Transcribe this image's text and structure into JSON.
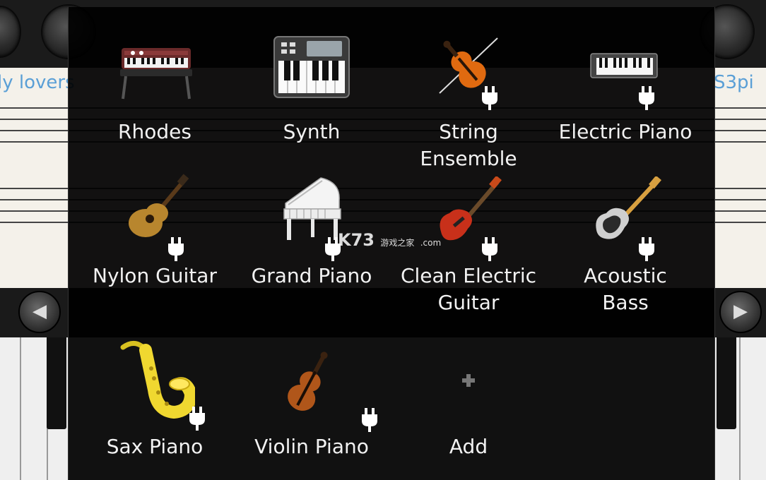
{
  "background": {
    "sheet_title_left": "ly lovers",
    "sheet_title_right": "S3pi",
    "nav_left_arrow": "◀",
    "nav_right_arrow": "▶"
  },
  "instrument_dialog": {
    "instruments": [
      {
        "label": "Rhodes",
        "icon": "rhodes-keyboard-icon",
        "plugin": false
      },
      {
        "label": "Synth",
        "icon": "synth-keyboard-icon",
        "plugin": false
      },
      {
        "label": "String\nEnsemble",
        "icon": "violin-bow-icon",
        "plugin": true
      },
      {
        "label": "Electric Piano",
        "icon": "electric-piano-icon",
        "plugin": true
      },
      {
        "label": "Nylon Guitar",
        "icon": "nylon-guitar-icon",
        "plugin": true
      },
      {
        "label": "Grand Piano",
        "icon": "grand-piano-icon",
        "plugin": true
      },
      {
        "label": "Clean Electric\nGuitar",
        "icon": "electric-guitar-icon",
        "plugin": true
      },
      {
        "label": "Acoustic\nBass",
        "icon": "bass-guitar-icon",
        "plugin": true
      },
      {
        "label": "Sax Piano",
        "icon": "saxophone-icon",
        "plugin": true
      },
      {
        "label": "Violin Piano",
        "icon": "violin-icon",
        "plugin": true
      },
      {
        "label": "Add",
        "icon": "plus-icon",
        "plugin": false
      }
    ]
  },
  "watermark": {
    "brand": "K73",
    "cn": "游戏之家",
    "domain": ".com"
  }
}
